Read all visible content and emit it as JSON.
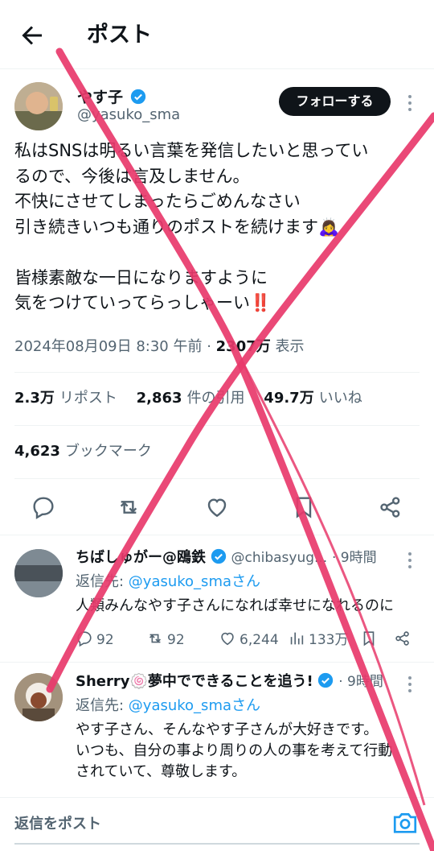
{
  "topbar": {
    "title": "ポスト"
  },
  "post": {
    "name": "やす子",
    "handle": "@yasuko_sma",
    "follow_label": "フォローする",
    "lines": [
      "私はSNSは明るい言葉を発信したいと思ってい",
      "るので、今後は言及しません。",
      "不快にさせてしまったらごめんなさい",
      "引き続きいつも通りのポストを続けます🙇‍♀️",
      "",
      "皆様素敵な一日になりますように",
      "気をつけていってらっしゃーい‼️"
    ],
    "timestamp": "2024年08月09日 8:30 午前",
    "views_count": "2307万",
    "views_label": "表示",
    "reposts_count": "2.3万",
    "reposts_label": "リポスト",
    "quotes_count": "2,863",
    "quotes_label": "件の引用",
    "likes_count": "49.7万",
    "likes_label": "いいね",
    "bookmarks_count": "4,623",
    "bookmarks_label": "ブックマーク"
  },
  "replies": [
    {
      "name": "ちばしゅがー@鴎鉄",
      "handle": "@chibasyug...",
      "time": "· 9時間",
      "reply_to_prefix": "返信先: ",
      "reply_to_handle": "@yasuko_smaさん",
      "text": "人類みんなやす子さんになれば幸せになれるのに",
      "replies": "92",
      "reposts": "92",
      "likes": "6,244",
      "views": "133万"
    },
    {
      "name": "Sherry🍥夢中でできることを追う!",
      "time": "· 9時間",
      "reply_to_prefix": "返信先: ",
      "reply_to_handle": "@yasuko_smaさん",
      "text_lines": [
        "やす子さん、そんなやす子さんが大好きです。",
        "いつも、自分の事より周りの人の事を考えて行動",
        "されていて、尊敬します。"
      ]
    }
  ],
  "composer": {
    "placeholder": "返信をポスト"
  },
  "colors": {
    "accent": "#1d9bf0",
    "overlay": "#e8396b",
    "text": "#0f1419",
    "muted": "#536471"
  }
}
